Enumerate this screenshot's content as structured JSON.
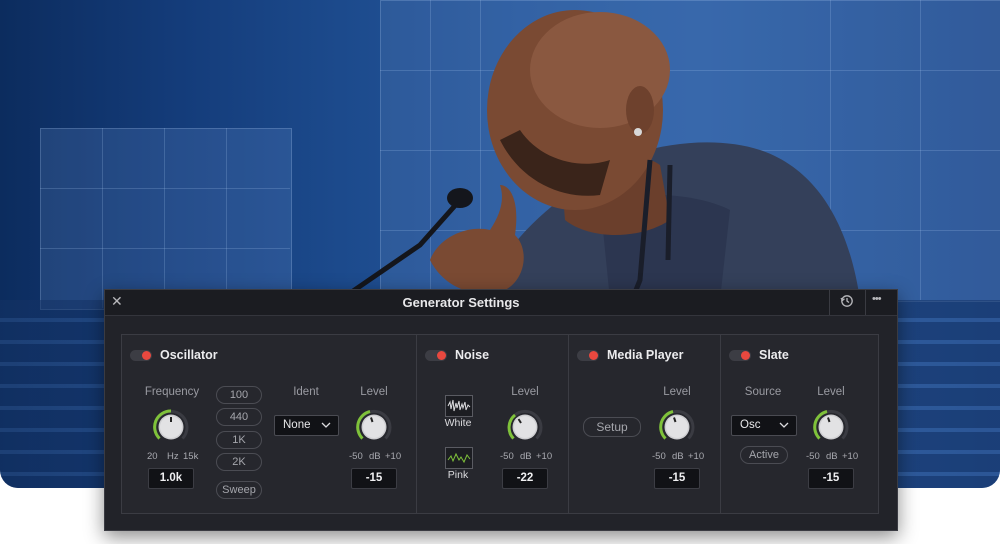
{
  "window": {
    "title": "Generator Settings",
    "close_icon": "close-icon",
    "history_icon": "history-icon",
    "more_icon": "more-icon",
    "close_glyph": "✕",
    "history_glyph": "↺",
    "more_glyph": "•••"
  },
  "colors": {
    "accent_red": "#e8483f",
    "knob_green": "#7fc23a",
    "panel_bg": "#222329"
  },
  "oscillator": {
    "title": "Oscillator",
    "enabled": true,
    "frequency_label": "Frequency",
    "frequency_min": "20",
    "frequency_unit": "Hz",
    "frequency_max": "15k",
    "frequency_value": "1.0k",
    "presets": [
      "100",
      "440",
      "1K",
      "2K",
      "Sweep"
    ],
    "ident_label": "Ident",
    "ident_value": "None",
    "level_label": "Level",
    "level_min": "-50",
    "level_unit": "dB",
    "level_max": "+10",
    "level_value": "-15"
  },
  "noise": {
    "title": "Noise",
    "enabled": true,
    "white_label": "White",
    "pink_label": "Pink",
    "level_label": "Level",
    "level_min": "-50",
    "level_unit": "dB",
    "level_max": "+10",
    "level_value": "-22"
  },
  "media_player": {
    "title": "Media Player",
    "enabled": true,
    "setup_label": "Setup",
    "level_label": "Level",
    "level_min": "-50",
    "level_unit": "dB",
    "level_max": "+10",
    "level_value": "-15"
  },
  "slate": {
    "title": "Slate",
    "enabled": true,
    "source_label": "Source",
    "source_value": "Osc",
    "active_label": "Active",
    "level_label": "Level",
    "level_min": "-50",
    "level_unit": "dB",
    "level_max": "+10",
    "level_value": "-15"
  },
  "chevron": "⌵"
}
